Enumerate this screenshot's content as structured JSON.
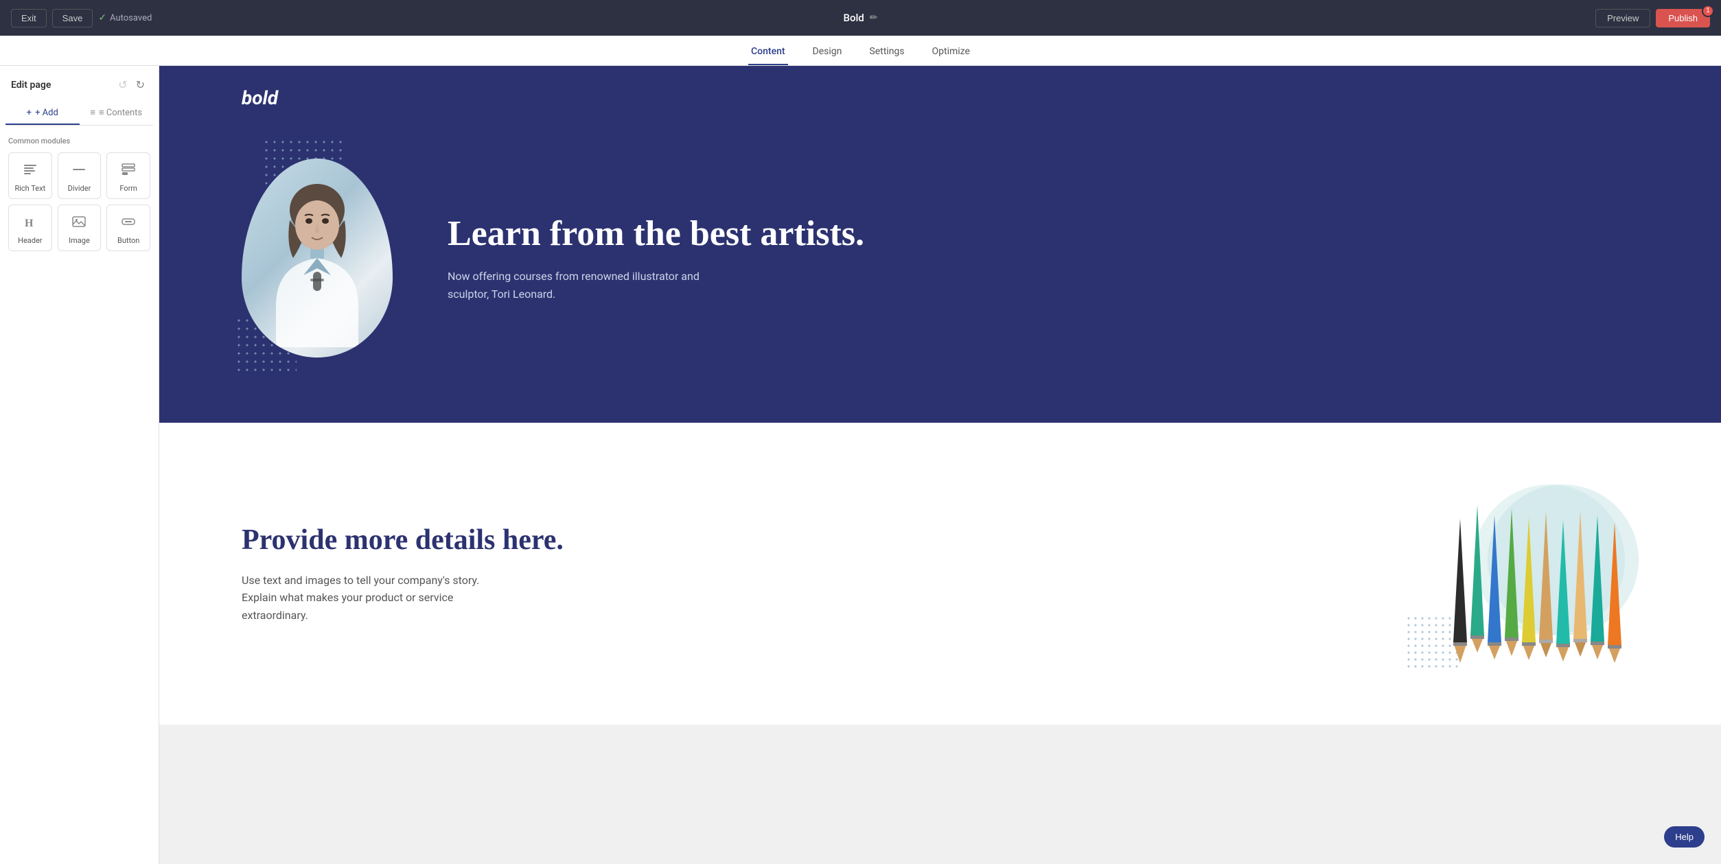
{
  "topbar": {
    "exit_label": "Exit",
    "save_label": "Save",
    "autosaved_text": "Autosaved",
    "page_title": "Bold",
    "preview_label": "Preview",
    "publish_label": "Publish",
    "publish_badge": "1"
  },
  "nav": {
    "tabs": [
      {
        "id": "content",
        "label": "Content",
        "active": true
      },
      {
        "id": "design",
        "label": "Design",
        "active": false
      },
      {
        "id": "settings",
        "label": "Settings",
        "active": false
      },
      {
        "id": "optimize",
        "label": "Optimize",
        "active": false
      }
    ]
  },
  "sidebar": {
    "title": "Edit page",
    "add_label": "+ Add",
    "contents_label": "≡ Contents",
    "module_section_title": "Common modules",
    "modules": [
      {
        "id": "rich-text",
        "label": "Rich Text",
        "icon": "¶"
      },
      {
        "id": "divider",
        "label": "Divider",
        "icon": "—"
      },
      {
        "id": "form",
        "label": "Form",
        "icon": "▦"
      },
      {
        "id": "header",
        "label": "Header",
        "icon": "H"
      },
      {
        "id": "image",
        "label": "Image",
        "icon": "⬜"
      },
      {
        "id": "button",
        "label": "Button",
        "icon": "□"
      }
    ]
  },
  "hero": {
    "logo": "bold",
    "title": "Learn from the best artists.",
    "subtitle": "Now offering courses from renowned illustrator and sculptor, Tori Leonard."
  },
  "content": {
    "title": "Provide more details here.",
    "body": "Use text and images to tell your company's story. Explain what makes your product or service extraordinary."
  },
  "help": {
    "label": "Help"
  }
}
